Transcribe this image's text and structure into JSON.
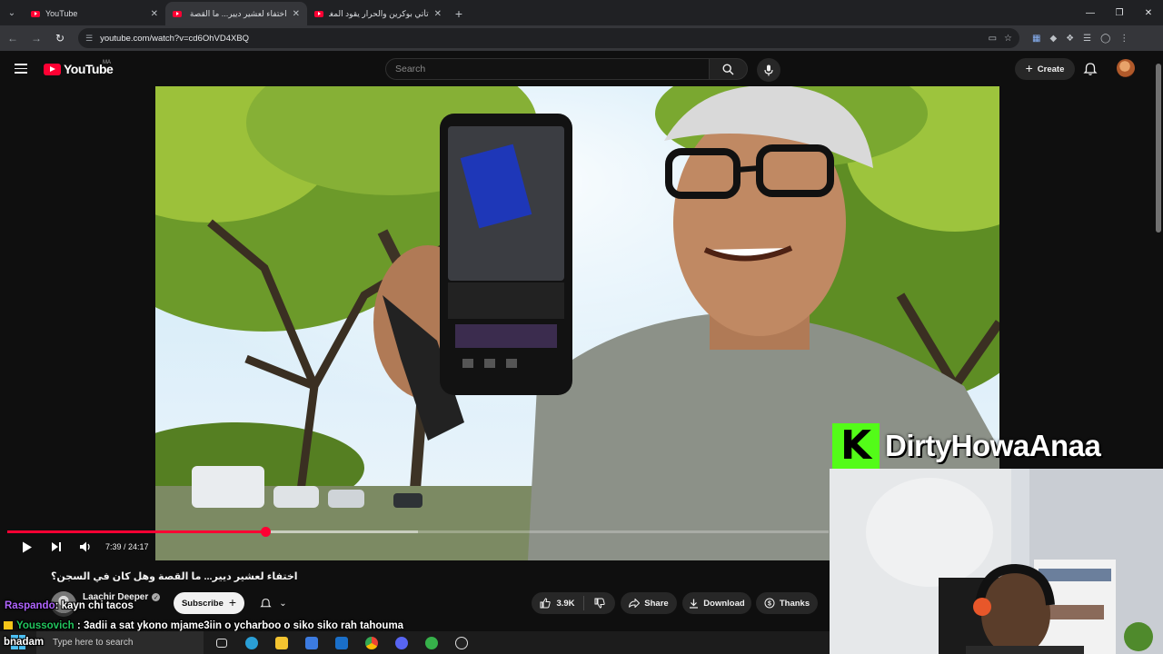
{
  "browser": {
    "tabs": [
      {
        "label": "YouTube",
        "active": false
      },
      {
        "label": "اختفاء لعشير ديير... ما القصة وهل",
        "active": true
      },
      {
        "label": "تأتي بوكرين والحرار يقود المغرب",
        "active": false
      }
    ],
    "url": "youtube.com/watch?v=cd6OhVD4XBQ"
  },
  "youtube": {
    "logo_text": "YouTube",
    "country_code": "MA",
    "search_placeholder": "Search",
    "create_label": "Create"
  },
  "player": {
    "current_time": "7:39",
    "duration": "24:17",
    "time_display": "7:39 / 24:17",
    "played_fraction": 0.315,
    "buffered_fraction": 0.5
  },
  "video_info": {
    "title": "اختفاء لعشير ديير... ما القصة وهل كان في السجن؟",
    "channel": "Laachir Deeper",
    "subscribe_label": "Subscribe",
    "likes": "3.9K",
    "share_label": "Share",
    "download_label": "Download",
    "thanks_label": "Thanks"
  },
  "stream_overlay": {
    "platform_letter": "K",
    "streamer_name": "DirtyHowaAnaa",
    "brand_color": "#53fc18"
  },
  "chat": [
    {
      "user": "Raspando",
      "message": "kayn chi tacos"
    },
    {
      "user": "Youssovich",
      "message": "3adii a sat ykono mjame3iin o ycharboo o siko siko rah tahouma"
    },
    {
      "user": "bnadam",
      "message": ""
    }
  ],
  "taskbar": {
    "search_placeholder": "Type here to search"
  },
  "colors": {
    "yt_red": "#ff0033",
    "background": "#0f0f0f",
    "kick_green": "#53fc18"
  }
}
